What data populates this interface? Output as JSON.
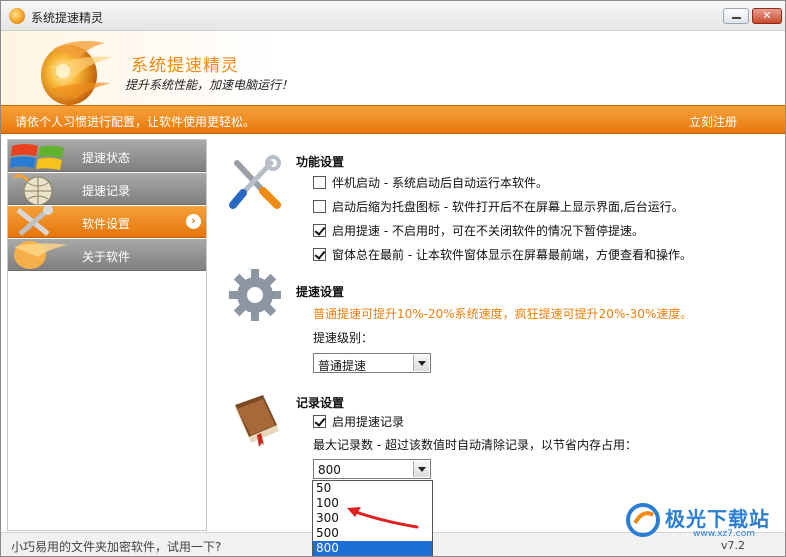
{
  "window": {
    "title": "系统提速精灵"
  },
  "header": {
    "brand_title": "系统提速精灵",
    "brand_subtitle": "提升系统性能，加速电脑运行！"
  },
  "banner": {
    "message": "请依个人习惯进行配置，让软件使用更轻松。",
    "register_label": "立刻注册"
  },
  "sidebar": {
    "items": [
      {
        "label": "提速状态",
        "icon": "windows-logo-icon"
      },
      {
        "label": "提速记录",
        "icon": "globe-icon"
      },
      {
        "label": "软件设置",
        "icon": "tools-icon",
        "active": true
      },
      {
        "label": "关于软件",
        "icon": "flame-icon"
      }
    ]
  },
  "function_settings": {
    "title": "功能设置",
    "options": [
      {
        "label": "伴机启动 - 系统启动后自动运行本软件。",
        "checked": false
      },
      {
        "label": "启动后缩为托盘图标 - 软件打开后不在屏幕上显示界面,后台运行。",
        "checked": false
      },
      {
        "label": "启用提速 - 不启用时，可在不关闭软件的情况下暂停提速。",
        "checked": true
      },
      {
        "label": "窗体总在最前 - 让本软件窗体显示在屏幕最前端，方便查看和操作。",
        "checked": true
      }
    ]
  },
  "speed_settings": {
    "title": "提速设置",
    "hint": "普通提速可提升10%-20%系统速度，疯狂提速可提升20%-30%速度。",
    "level_label": "提速级别：",
    "level_value": "普通提速"
  },
  "record_settings": {
    "title": "记录设置",
    "enable_label": "启用提速记录",
    "enable_checked": true,
    "max_label": "最大记录数 - 超过该数值时自动清除记录，以节省内存占用：",
    "max_value": "800",
    "options": [
      "50",
      "100",
      "300",
      "500",
      "800"
    ],
    "selected_index": 4
  },
  "footer": {
    "ad_text": "小巧易用的文件夹加密软件，试用一下?",
    "version": "v7.2"
  },
  "watermark": {
    "text": "极光下载站",
    "url": "www.xz7.com"
  },
  "colors": {
    "accent_orange": "#e8780e",
    "hint_orange": "#ef7d0a",
    "selection_blue": "#1d6fd6"
  }
}
